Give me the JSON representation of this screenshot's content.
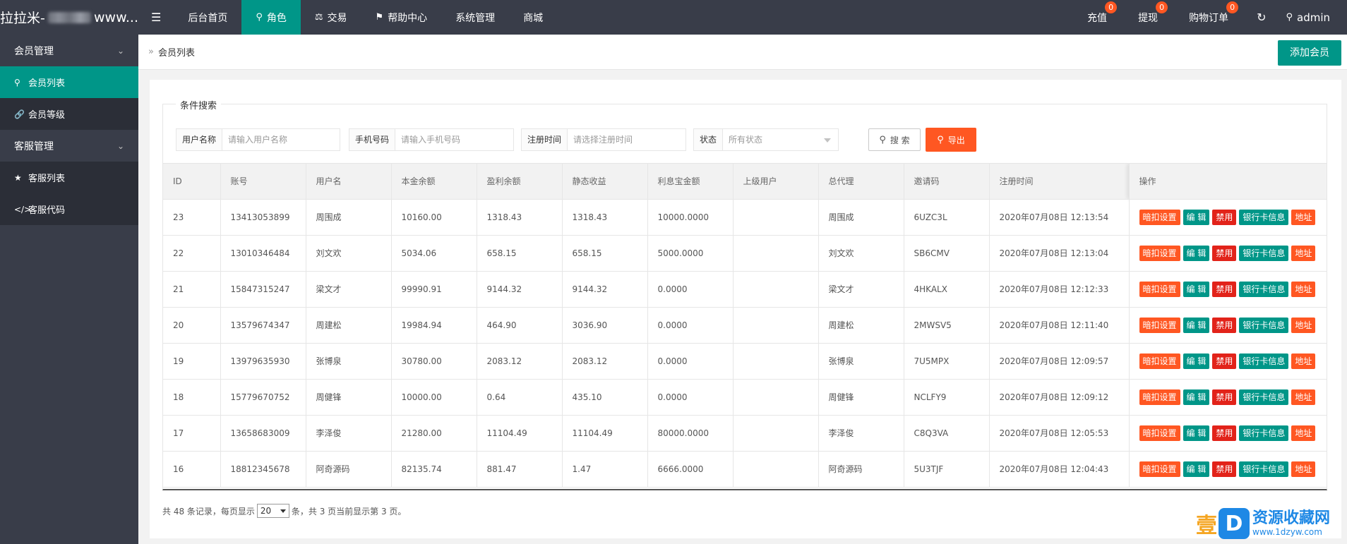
{
  "app": {
    "logo_prefix": "拉拉米-",
    "logo_suffix": "www..."
  },
  "nav": {
    "toggle_icon": "☰",
    "items": [
      {
        "label": "后台首页",
        "icon": ""
      },
      {
        "label": "角色",
        "icon": "user-icon"
      },
      {
        "label": "交易",
        "icon": "scale-icon"
      },
      {
        "label": "帮助中心",
        "icon": "flag-icon"
      },
      {
        "label": "系统管理",
        "icon": ""
      },
      {
        "label": "商城",
        "icon": ""
      }
    ],
    "active_index": 1
  },
  "topright": {
    "recharge": {
      "label": "充值",
      "badge": "0"
    },
    "withdraw": {
      "label": "提现",
      "badge": "0"
    },
    "orders": {
      "label": "购物订单",
      "badge": "0"
    },
    "refresh_icon": "refresh-icon",
    "user": "admin"
  },
  "sidebar": {
    "groups": [
      {
        "label": "会员管理",
        "items": [
          {
            "label": "会员列表",
            "icon": "user-icon",
            "active": true
          },
          {
            "label": "会员等级",
            "icon": "link-icon",
            "active": false
          }
        ]
      },
      {
        "label": "客服管理",
        "items": [
          {
            "label": "客服列表",
            "icon": "users-icon",
            "active": false
          },
          {
            "label": "客服代码",
            "icon": "code-icon",
            "active": false
          }
        ]
      }
    ]
  },
  "page": {
    "breadcrumb_icon": "»",
    "breadcrumb": "会员列表",
    "add_button": "添加会员"
  },
  "search": {
    "legend": "条件搜索",
    "fields": {
      "username": {
        "label": "用户名称",
        "placeholder": "请输入用户名称",
        "value": ""
      },
      "phone": {
        "label": "手机号码",
        "placeholder": "请输入手机号码",
        "value": ""
      },
      "regtime": {
        "label": "注册时间",
        "placeholder": "请选择注册时间",
        "value": ""
      },
      "status": {
        "label": "状态",
        "selected": "所有状态"
      }
    },
    "search_button": "搜 索",
    "export_button": "导出"
  },
  "table": {
    "columns": [
      "ID",
      "账号",
      "用户名",
      "本金余额",
      "盈利余额",
      "静态收益",
      "利息宝金额",
      "上级用户",
      "总代理",
      "邀请码",
      "注册时间",
      "操作"
    ],
    "actions": [
      "暗扣设置",
      "编 辑",
      "禁用",
      "银行卡信息",
      "地址"
    ],
    "rows": [
      {
        "id": "23",
        "account": "13413053899",
        "name": "周围成",
        "principal": "10160.00",
        "profit": "1318.43",
        "static": "1318.43",
        "interest": "10000.0000",
        "parent": "",
        "agent": "周围成",
        "code": "6UZC3L",
        "time": "2020年07月08日 12:13:54"
      },
      {
        "id": "22",
        "account": "13010346484",
        "name": "刘文欢",
        "principal": "5034.06",
        "profit": "658.15",
        "static": "658.15",
        "interest": "5000.0000",
        "parent": "",
        "agent": "刘文欢",
        "code": "SB6CMV",
        "time": "2020年07月08日 12:13:04"
      },
      {
        "id": "21",
        "account": "15847315247",
        "name": "梁文才",
        "principal": "99990.91",
        "profit": "9144.32",
        "static": "9144.32",
        "interest": "0.0000",
        "parent": "",
        "agent": "梁文才",
        "code": "4HKALX",
        "time": "2020年07月08日 12:12:33"
      },
      {
        "id": "20",
        "account": "13579674347",
        "name": "周建松",
        "principal": "19984.94",
        "profit": "464.90",
        "static": "3036.90",
        "interest": "0.0000",
        "parent": "",
        "agent": "周建松",
        "code": "2MWSV5",
        "time": "2020年07月08日 12:11:40"
      },
      {
        "id": "19",
        "account": "13979635930",
        "name": "张博泉",
        "principal": "30780.00",
        "profit": "2083.12",
        "static": "2083.12",
        "interest": "0.0000",
        "parent": "",
        "agent": "张博泉",
        "code": "7U5MPX",
        "time": "2020年07月08日 12:09:57"
      },
      {
        "id": "18",
        "account": "15779670752",
        "name": "周健锋",
        "principal": "10000.00",
        "profit": "0.64",
        "static": "435.10",
        "interest": "0.0000",
        "parent": "",
        "agent": "周健锋",
        "code": "NCLFY9",
        "time": "2020年07月08日 12:09:12"
      },
      {
        "id": "17",
        "account": "13658683009",
        "name": "李泽俊",
        "principal": "21280.00",
        "profit": "11104.49",
        "static": "11104.49",
        "interest": "80000.0000",
        "parent": "",
        "agent": "李泽俊",
        "code": "C8Q3VA",
        "time": "2020年07月08日 12:05:53"
      },
      {
        "id": "16",
        "account": "18812345678",
        "name": "阿奇源码",
        "principal": "82135.74",
        "profit": "881.47",
        "static": "1.47",
        "interest": "6666.0000",
        "parent": "",
        "agent": "阿奇源码",
        "code": "5U3TJF",
        "time": "2020年07月08日 12:04:43"
      }
    ]
  },
  "pager": {
    "before": "共 48 条记录，每页显示",
    "page_size": "20",
    "after": "条，共 3 页当前显示第 3 页。"
  },
  "watermark": {
    "yi": "壹",
    "d": "D",
    "title": "资源收藏网",
    "url": "www.1dzyw.com"
  },
  "colors": {
    "topbar": "#393d49",
    "accent": "#009688",
    "orange": "#ff5722",
    "red": "#e2231a"
  }
}
